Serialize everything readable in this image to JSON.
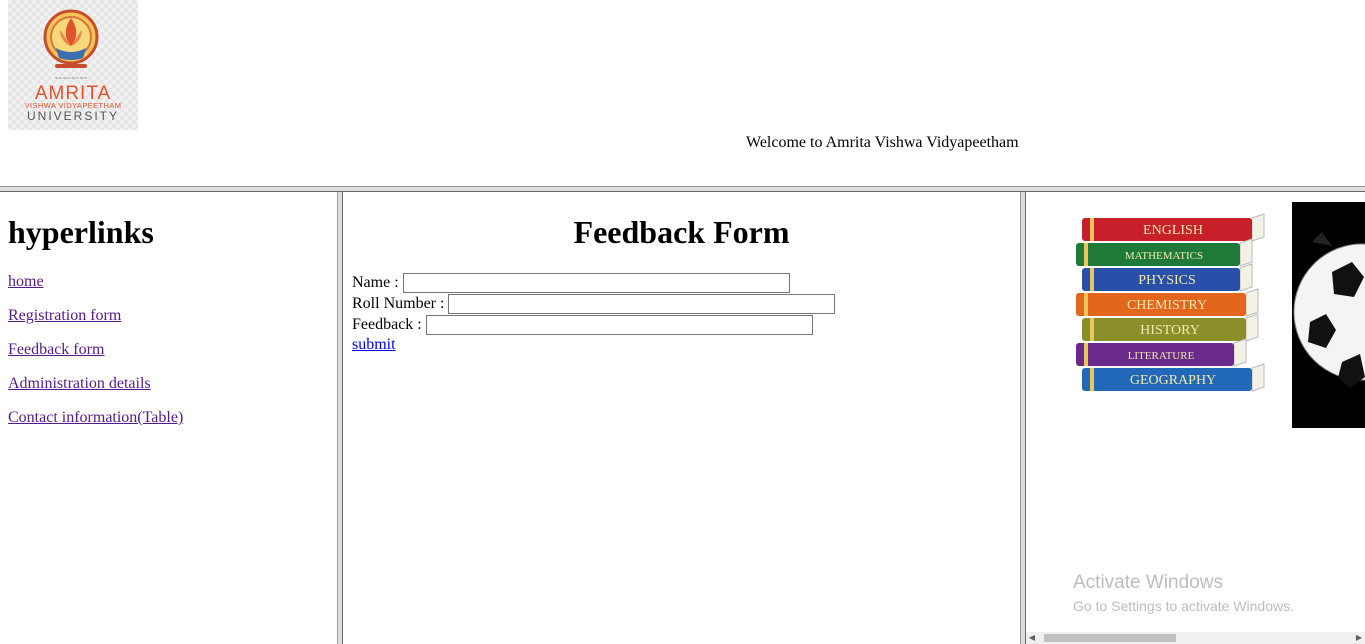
{
  "header": {
    "logo": {
      "icon": "amrita-university-logo",
      "name": "AMRITA",
      "subtitle": "VISHWA VIDYAPEETHAM",
      "university": "UNIVERSITY"
    },
    "welcome_text": "Welcome to Amrita Vishwa Vidyapeetham"
  },
  "sidebar": {
    "heading": "hyperlinks",
    "links": [
      {
        "label": "home"
      },
      {
        "label": "Registration form"
      },
      {
        "label": "Feedback form"
      },
      {
        "label": "Administration details"
      },
      {
        "label": "Contact information(Table)"
      }
    ]
  },
  "form": {
    "title": "Feedback Form",
    "fields": [
      {
        "label": "Name :",
        "value": ""
      },
      {
        "label": "Roll Number :",
        "value": ""
      },
      {
        "label": "Feedback :",
        "value": ""
      }
    ],
    "submit_label": "submit"
  },
  "right_panel": {
    "books_image": {
      "icon": "stacked-books-image",
      "titles": [
        "ENGLISH",
        "MATHEMATICS",
        "PHYSICS",
        "CHEMISTRY",
        "HISTORY",
        "LITERATURE",
        "GEOGRAPHY"
      ]
    },
    "ball_image": {
      "icon": "soccer-ball-image"
    },
    "watermark": {
      "title": "Activate Windows",
      "subtitle": "Go to Settings to activate Windows."
    }
  }
}
